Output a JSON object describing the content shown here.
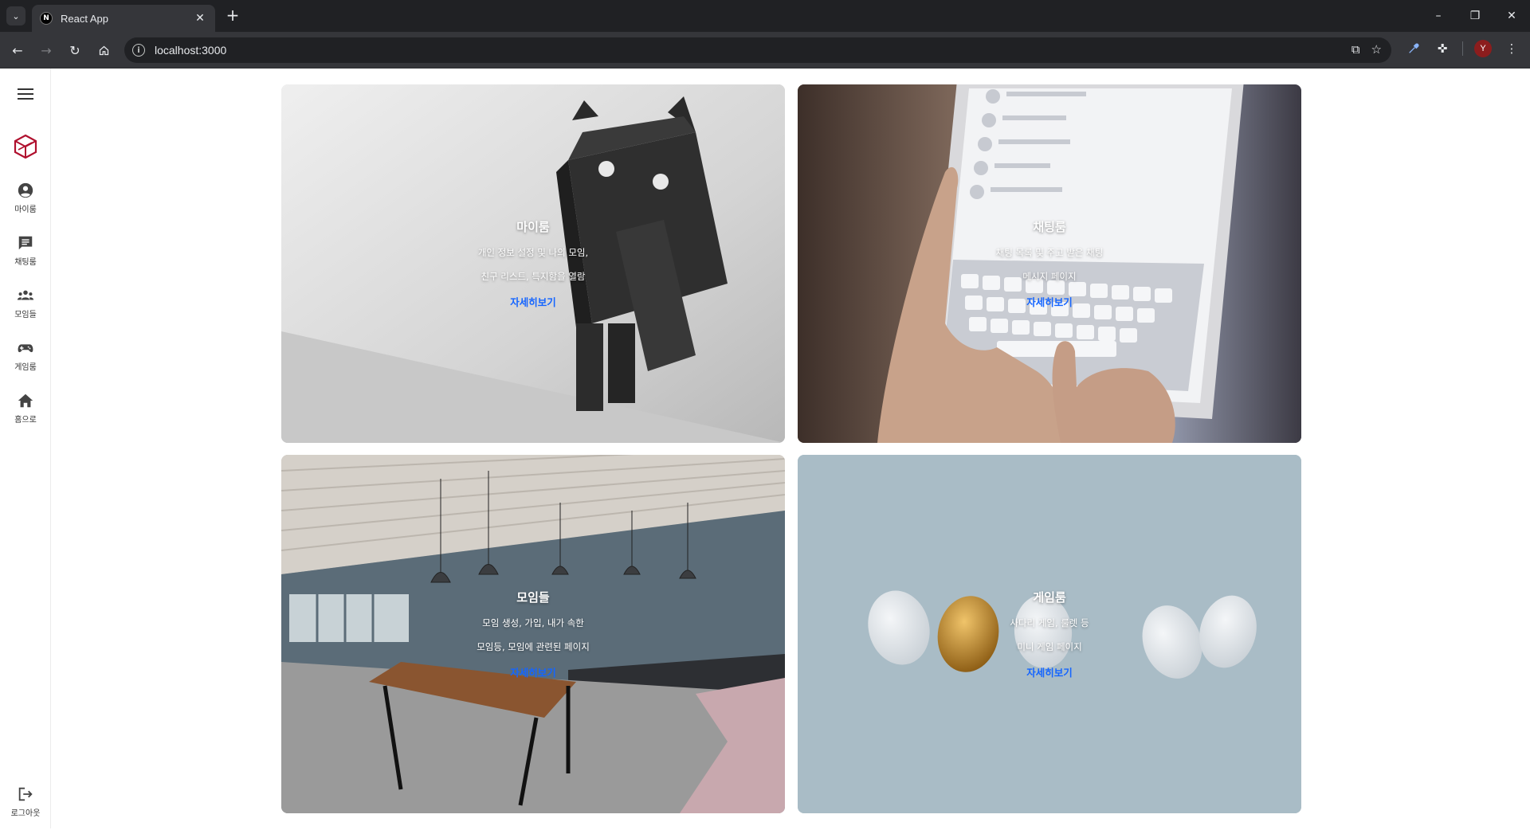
{
  "browser": {
    "tab_title": "React App",
    "url": "localhost:3000",
    "profile_initial": "Y"
  },
  "sidebar": {
    "items": [
      {
        "label": "마이룸",
        "icon": "account-circle-icon"
      },
      {
        "label": "채팅룸",
        "icon": "chat-icon"
      },
      {
        "label": "모임들",
        "icon": "groups-icon"
      },
      {
        "label": "게임룸",
        "icon": "gamepad-icon"
      },
      {
        "label": "홈으로",
        "icon": "home-icon"
      }
    ],
    "logout_label": "로그아웃"
  },
  "cards": [
    {
      "title": "마이룸",
      "line1": "개인 정보 설정 및 나의 모임,",
      "line2": "친구 리스트, 특지함을 열람",
      "link": "자세히보기"
    },
    {
      "title": "채팅룸",
      "line1": "채팅 목록 및 주고 받은 채팅",
      "line2": "메시지 페이지",
      "link": "자세히보기"
    },
    {
      "title": "모임들",
      "line1": "모임 생성, 가입, 내가 속한",
      "line2": "모임등, 모임에 관련된 페이지",
      "link": "자세히보기"
    },
    {
      "title": "게임룸",
      "line1": "사다리 게임, 룰렛 등",
      "line2": "미니 게임 페이지",
      "link": "자세히보기"
    }
  ],
  "colors": {
    "link": "#1565ff",
    "chrome_dark": "#202124",
    "chrome_toolbar": "#35363a",
    "brand": "#b0102e"
  }
}
